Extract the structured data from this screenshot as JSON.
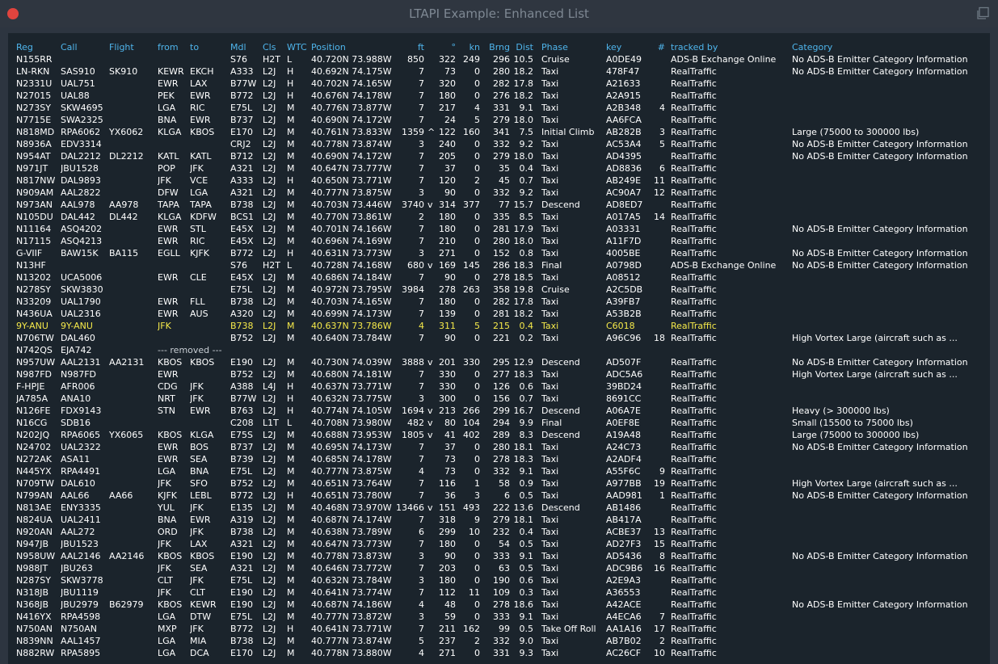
{
  "window": {
    "title": "LTAPI Example: Enhanced List"
  },
  "columns": {
    "reg": "Reg",
    "call": "Call",
    "flight": "Flight",
    "from": "from",
    "to": "to",
    "mdl": "Mdl",
    "cls": "Cls",
    "wtc": "WTC",
    "position": "Position",
    "ft": "ft",
    "deg": "°",
    "kn": "kn",
    "brng": "Brng",
    "dist": "Dist",
    "phase": "Phase",
    "key": "key",
    "num": "#",
    "tracked": "tracked by",
    "category": "Category"
  },
  "colors": {
    "header": "#4fb5ec",
    "highlight": "#f5e94a",
    "text": "#ffffff",
    "panel": "#1b242c",
    "close": "#e0443e"
  },
  "rows": [
    [
      "N155RR",
      "",
      "",
      "",
      "",
      "S76",
      "H2T",
      "L",
      "40.720N 73.988W",
      "850",
      "",
      "322",
      "249",
      "296",
      "10.5",
      "Cruise",
      "A0DE49",
      "",
      "ADS-B Exchange Online",
      "No ADS-B Emitter Category Information"
    ],
    [
      "LN-RKN",
      "SAS910",
      "SK910",
      "KEWR",
      "EKCH",
      "A333",
      "L2J",
      "H",
      "40.692N 74.175W",
      "7",
      "",
      "73",
      "0",
      "280",
      "18.2",
      "Taxi",
      "478F47",
      "",
      "RealTraffic",
      "No ADS-B Emitter Category Information"
    ],
    [
      "N2331U",
      "UAL751",
      "",
      "EWR",
      "LAX",
      "B77W",
      "L2J",
      "H",
      "40.702N 74.165W",
      "7",
      "",
      "320",
      "0",
      "282",
      "17.8",
      "Taxi",
      "A21633",
      "",
      "RealTraffic",
      ""
    ],
    [
      "N27015",
      "UAL88",
      "",
      "PEK",
      "EWR",
      "B772",
      "L2J",
      "H",
      "40.676N 74.178W",
      "7",
      "",
      "180",
      "0",
      "276",
      "18.2",
      "Taxi",
      "A2A915",
      "",
      "RealTraffic",
      ""
    ],
    [
      "N273SY",
      "SKW4695",
      "",
      "LGA",
      "RIC",
      "E75L",
      "L2J",
      "M",
      "40.776N 73.877W",
      "7",
      "",
      "217",
      "4",
      "331",
      "9.1",
      "Taxi",
      "A2B348",
      "4",
      "RealTraffic",
      ""
    ],
    [
      "N7715E",
      "SWA2325",
      "",
      "BNA",
      "EWR",
      "B737",
      "L2J",
      "M",
      "40.690N 74.172W",
      "7",
      "",
      "24",
      "5",
      "279",
      "18.0",
      "Taxi",
      "AA6FCA",
      "",
      "RealTraffic",
      ""
    ],
    [
      "N818MD",
      "RPA6062",
      "YX6062",
      "KLGA",
      "KBOS",
      "E170",
      "L2J",
      "M",
      "40.761N 73.833W",
      "1359",
      "^",
      "122",
      "160",
      "341",
      "7.5",
      "Initial Climb",
      "AB282B",
      "3",
      "RealTraffic",
      "Large (75000 to 300000 lbs)"
    ],
    [
      "N8936A",
      "EDV3314",
      "",
      "",
      "",
      "CRJ2",
      "L2J",
      "M",
      "40.778N 73.874W",
      "3",
      "",
      "240",
      "0",
      "332",
      "9.2",
      "Taxi",
      "AC53A4",
      "5",
      "RealTraffic",
      "No ADS-B Emitter Category Information"
    ],
    [
      "N954AT",
      "DAL2212",
      "DL2212",
      "KATL",
      "KATL",
      "B712",
      "L2J",
      "M",
      "40.690N 74.172W",
      "7",
      "",
      "205",
      "0",
      "279",
      "18.0",
      "Taxi",
      "AD4395",
      "",
      "RealTraffic",
      "No ADS-B Emitter Category Information"
    ],
    [
      "N971JT",
      "JBU1528",
      "",
      "POP",
      "JFK",
      "A321",
      "L2J",
      "M",
      "40.647N 73.777W",
      "7",
      "",
      "37",
      "0",
      "35",
      "0.4",
      "Taxi",
      "AD8836",
      "6",
      "RealTraffic",
      ""
    ],
    [
      "N817NW",
      "DAL9893",
      "",
      "JFK",
      "VCE",
      "A333",
      "L2J",
      "H",
      "40.650N 73.771W",
      "7",
      "",
      "120",
      "2",
      "45",
      "0.7",
      "Taxi",
      "AB249E",
      "11",
      "RealTraffic",
      ""
    ],
    [
      "N909AM",
      "AAL2822",
      "",
      "DFW",
      "LGA",
      "A321",
      "L2J",
      "M",
      "40.777N 73.875W",
      "3",
      "",
      "90",
      "0",
      "332",
      "9.2",
      "Taxi",
      "AC90A7",
      "12",
      "RealTraffic",
      ""
    ],
    [
      "N973AN",
      "AAL978",
      "AA978",
      "TAPA",
      "TAPA",
      "B738",
      "L2J",
      "M",
      "40.703N 73.446W",
      "3740",
      "v",
      "314",
      "377",
      "77",
      "15.7",
      "Descend",
      "AD8ED7",
      "",
      "RealTraffic",
      ""
    ],
    [
      "N105DU",
      "DAL442",
      "DL442",
      "KLGA",
      "KDFW",
      "BCS1",
      "L2J",
      "M",
      "40.770N 73.861W",
      "2",
      "",
      "180",
      "0",
      "335",
      "8.5",
      "Taxi",
      "A017A5",
      "14",
      "RealTraffic",
      ""
    ],
    [
      "N11164",
      "ASQ4202",
      "",
      "EWR",
      "STL",
      "E45X",
      "L2J",
      "M",
      "40.701N 74.166W",
      "7",
      "",
      "180",
      "0",
      "281",
      "17.9",
      "Taxi",
      "A03331",
      "",
      "RealTraffic",
      "No ADS-B Emitter Category Information"
    ],
    [
      "N17115",
      "ASQ4213",
      "",
      "EWR",
      "RIC",
      "E45X",
      "L2J",
      "M",
      "40.696N 74.169W",
      "7",
      "",
      "210",
      "0",
      "280",
      "18.0",
      "Taxi",
      "A11F7D",
      "",
      "RealTraffic",
      ""
    ],
    [
      "G-VIIF",
      "BAW15K",
      "BA115",
      "EGLL",
      "KJFK",
      "B772",
      "L2J",
      "H",
      "40.631N 73.773W",
      "3",
      "",
      "271",
      "0",
      "152",
      "0.8",
      "Taxi",
      "4005BE",
      "",
      "RealTraffic",
      "No ADS-B Emitter Category Information"
    ],
    [
      "N13HF",
      "",
      "",
      "",
      "",
      "S76",
      "H2T",
      "L",
      "40.728N 74.168W",
      "680",
      "v",
      "169",
      "145",
      "286",
      "18.3",
      "Final",
      "A0798D",
      "",
      "ADS-B Exchange Online",
      "No ADS-B Emitter Category Information"
    ],
    [
      "N13202",
      "UCA5006",
      "",
      "EWR",
      "CLE",
      "E45X",
      "L2J",
      "M",
      "40.686N 74.184W",
      "7",
      "",
      "90",
      "0",
      "278",
      "18.5",
      "Taxi",
      "A08512",
      "",
      "RealTraffic",
      ""
    ],
    [
      "N278SY",
      "SKW3830",
      "",
      "",
      "",
      "E75L",
      "L2J",
      "M",
      "40.972N 73.795W",
      "3984",
      "",
      "278",
      "263",
      "358",
      "19.8",
      "Cruise",
      "A2C5DB",
      "",
      "RealTraffic",
      ""
    ],
    [
      "N33209",
      "UAL1790",
      "",
      "EWR",
      "FLL",
      "B738",
      "L2J",
      "M",
      "40.703N 74.165W",
      "7",
      "",
      "180",
      "0",
      "282",
      "17.8",
      "Taxi",
      "A39FB7",
      "",
      "RealTraffic",
      ""
    ],
    [
      "N436UA",
      "UAL2316",
      "",
      "EWR",
      "AUS",
      "A320",
      "L2J",
      "M",
      "40.699N 74.173W",
      "7",
      "",
      "139",
      "0",
      "281",
      "18.2",
      "Taxi",
      "A53B2B",
      "",
      "RealTraffic",
      ""
    ],
    [
      "9Y-ANU",
      "9Y-ANU",
      "",
      "JFK",
      "",
      "B738",
      "L2J",
      "M",
      "40.637N 73.786W",
      "4",
      "",
      "311",
      "5",
      "215",
      "0.4",
      "Taxi",
      "C6018",
      "",
      "RealTraffic",
      ""
    ],
    [
      "N706TW",
      "DAL460",
      "",
      "",
      "",
      "B752",
      "L2J",
      "M",
      "40.640N 73.784W",
      "7",
      "",
      "90",
      "0",
      "221",
      "0.2",
      "Taxi",
      "A96C96",
      "18",
      "RealTraffic",
      "High Vortex Large (aircraft such as ..."
    ],
    [
      "N742QS",
      "EJA742",
      "--- removed ---",
      "",
      "",
      "",
      "",
      "",
      "",
      "",
      "",
      "",
      "",
      "",
      "",
      "",
      "",
      "",
      "",
      ""
    ],
    [
      "N957UW",
      "AAL2131",
      "AA2131",
      "KBOS",
      "KBOS",
      "E190",
      "L2J",
      "M",
      "40.730N 74.039W",
      "3888",
      "v",
      "201",
      "330",
      "295",
      "12.9",
      "Descend",
      "AD507F",
      "",
      "RealTraffic",
      "No ADS-B Emitter Category Information"
    ],
    [
      "N987FD",
      "N987FD",
      "",
      "EWR",
      "",
      "B752",
      "L2J",
      "M",
      "40.680N 74.181W",
      "7",
      "",
      "330",
      "0",
      "277",
      "18.3",
      "Taxi",
      "ADC5A6",
      "",
      "RealTraffic",
      "High Vortex Large (aircraft such as ..."
    ],
    [
      "F-HPJE",
      "AFR006",
      "",
      "CDG",
      "JFK",
      "A388",
      "L4J",
      "H",
      "40.637N 73.771W",
      "7",
      "",
      "330",
      "0",
      "126",
      "0.6",
      "Taxi",
      "39BD24",
      "",
      "RealTraffic",
      ""
    ],
    [
      "JA785A",
      "ANA10",
      "",
      "NRT",
      "JFK",
      "B77W",
      "L2J",
      "H",
      "40.632N 73.775W",
      "3",
      "",
      "300",
      "0",
      "156",
      "0.7",
      "Taxi",
      "8691CC",
      "",
      "RealTraffic",
      ""
    ],
    [
      "N126FE",
      "FDX9143",
      "",
      "STN",
      "EWR",
      "B763",
      "L2J",
      "H",
      "40.774N 74.105W",
      "1694",
      "v",
      "213",
      "266",
      "299",
      "16.7",
      "Descend",
      "A06A7E",
      "",
      "RealTraffic",
      "Heavy (> 300000 lbs)"
    ],
    [
      "N16CG",
      "SDB16",
      "",
      "",
      "",
      "C208",
      "L1T",
      "L",
      "40.708N 73.980W",
      "482",
      "v",
      "80",
      "104",
      "294",
      "9.9",
      "Final",
      "A0EF8E",
      "",
      "RealTraffic",
      "Small (15500 to 75000 lbs)"
    ],
    [
      "N202JQ",
      "RPA6065",
      "YX6065",
      "KBOS",
      "KLGA",
      "E75S",
      "L2J",
      "M",
      "40.688N 73.953W",
      "1805",
      "v",
      "41",
      "402",
      "289",
      "8.3",
      "Descend",
      "A19A48",
      "",
      "RealTraffic",
      "Large (75000 to 300000 lbs)"
    ],
    [
      "N24702",
      "UAL2322",
      "",
      "EWR",
      "BOS",
      "B737",
      "L2J",
      "M",
      "40.695N 74.173W",
      "7",
      "",
      "37",
      "0",
      "280",
      "18.1",
      "Taxi",
      "A24C73",
      "",
      "RealTraffic",
      "No ADS-B Emitter Category Information"
    ],
    [
      "N272AK",
      "ASA11",
      "",
      "EWR",
      "SEA",
      "B739",
      "L2J",
      "M",
      "40.685N 74.178W",
      "7",
      "",
      "73",
      "0",
      "278",
      "18.3",
      "Taxi",
      "A2ADF4",
      "",
      "RealTraffic",
      ""
    ],
    [
      "N445YX",
      "RPA4491",
      "",
      "LGA",
      "BNA",
      "E75L",
      "L2J",
      "M",
      "40.777N 73.875W",
      "4",
      "",
      "73",
      "0",
      "332",
      "9.1",
      "Taxi",
      "A55F6C",
      "9",
      "RealTraffic",
      ""
    ],
    [
      "N709TW",
      "DAL610",
      "",
      "JFK",
      "SFO",
      "B752",
      "L2J",
      "M",
      "40.651N 73.764W",
      "7",
      "",
      "116",
      "1",
      "58",
      "0.9",
      "Taxi",
      "A977BB",
      "19",
      "RealTraffic",
      "High Vortex Large (aircraft such as ..."
    ],
    [
      "N799AN",
      "AAL66",
      "AA66",
      "KJFK",
      "LEBL",
      "B772",
      "L2J",
      "H",
      "40.651N 73.780W",
      "7",
      "",
      "36",
      "3",
      "6",
      "0.5",
      "Taxi",
      "AAD981",
      "1",
      "RealTraffic",
      "No ADS-B Emitter Category Information"
    ],
    [
      "N813AE",
      "ENY3335",
      "",
      "YUL",
      "JFK",
      "E135",
      "L2J",
      "M",
      "40.468N 73.970W",
      "13466",
      "v",
      "151",
      "493",
      "222",
      "13.6",
      "Descend",
      "AB1486",
      "",
      "RealTraffic",
      ""
    ],
    [
      "N824UA",
      "UAL2411",
      "",
      "BNA",
      "EWR",
      "A319",
      "L2J",
      "M",
      "40.687N 74.174W",
      "7",
      "",
      "318",
      "9",
      "279",
      "18.1",
      "Taxi",
      "AB417A",
      "",
      "RealTraffic",
      ""
    ],
    [
      "N920AN",
      "AAL272",
      "",
      "ORD",
      "JFK",
      "B738",
      "L2J",
      "M",
      "40.638N 73.789W",
      "6",
      "",
      "299",
      "10",
      "232",
      "0.4",
      "Taxi",
      "ACBE37",
      "13",
      "RealTraffic",
      ""
    ],
    [
      "N947JB",
      "JBU1523",
      "",
      "JFK",
      "LAX",
      "A321",
      "L2J",
      "M",
      "40.647N 73.773W",
      "7",
      "",
      "180",
      "0",
      "54",
      "0.5",
      "Taxi",
      "AD27F3",
      "15",
      "RealTraffic",
      ""
    ],
    [
      "N958UW",
      "AAL2146",
      "AA2146",
      "KBOS",
      "KBOS",
      "E190",
      "L2J",
      "M",
      "40.778N 73.873W",
      "3",
      "",
      "90",
      "0",
      "333",
      "9.1",
      "Taxi",
      "AD5436",
      "8",
      "RealTraffic",
      "No ADS-B Emitter Category Information"
    ],
    [
      "N988JT",
      "JBU263",
      "",
      "JFK",
      "SEA",
      "A321",
      "L2J",
      "M",
      "40.646N 73.772W",
      "7",
      "",
      "203",
      "0",
      "63",
      "0.5",
      "Taxi",
      "ADC9B6",
      "16",
      "RealTraffic",
      ""
    ],
    [
      "N287SY",
      "SKW3778",
      "",
      "CLT",
      "JFK",
      "E75L",
      "L2J",
      "M",
      "40.632N 73.784W",
      "3",
      "",
      "180",
      "0",
      "190",
      "0.6",
      "Taxi",
      "A2E9A3",
      "",
      "RealTraffic",
      ""
    ],
    [
      "N318JB",
      "JBU1119",
      "",
      "JFK",
      "CLT",
      "E190",
      "L2J",
      "M",
      "40.641N 73.774W",
      "7",
      "",
      "112",
      "11",
      "109",
      "0.3",
      "Taxi",
      "A36553",
      "",
      "RealTraffic",
      ""
    ],
    [
      "N368JB",
      "JBU2979",
      "B62979",
      "KBOS",
      "KEWR",
      "E190",
      "L2J",
      "M",
      "40.687N 74.186W",
      "4",
      "",
      "48",
      "0",
      "278",
      "18.6",
      "Taxi",
      "A42ACE",
      "",
      "RealTraffic",
      "No ADS-B Emitter Category Information"
    ],
    [
      "N416YX",
      "RPA4598",
      "",
      "LGA",
      "DTW",
      "E75L",
      "L2J",
      "M",
      "40.777N 73.872W",
      "3",
      "",
      "59",
      "0",
      "333",
      "9.1",
      "Taxi",
      "A4ECA6",
      "7",
      "RealTraffic",
      ""
    ],
    [
      "N750AN",
      "N750AN",
      "",
      "MXP",
      "JFK",
      "B772",
      "L2J",
      "H",
      "40.641N 73.771W",
      "7",
      "",
      "211",
      "162",
      "99",
      "0.5",
      "Take Off Roll",
      "AA1A16",
      "17",
      "RealTraffic",
      ""
    ],
    [
      "N839NN",
      "AAL1457",
      "",
      "LGA",
      "MIA",
      "B738",
      "L2J",
      "M",
      "40.777N 73.874W",
      "5",
      "",
      "237",
      "2",
      "332",
      "9.0",
      "Taxi",
      "AB7B02",
      "2",
      "RealTraffic",
      ""
    ],
    [
      "N882RW",
      "RPA5895",
      "",
      "LGA",
      "DCA",
      "E170",
      "L2J",
      "M",
      "40.778N 73.880W",
      "4",
      "",
      "271",
      "0",
      "331",
      "9.3",
      "Taxi",
      "AC26CF",
      "10",
      "RealTraffic",
      ""
    ]
  ]
}
